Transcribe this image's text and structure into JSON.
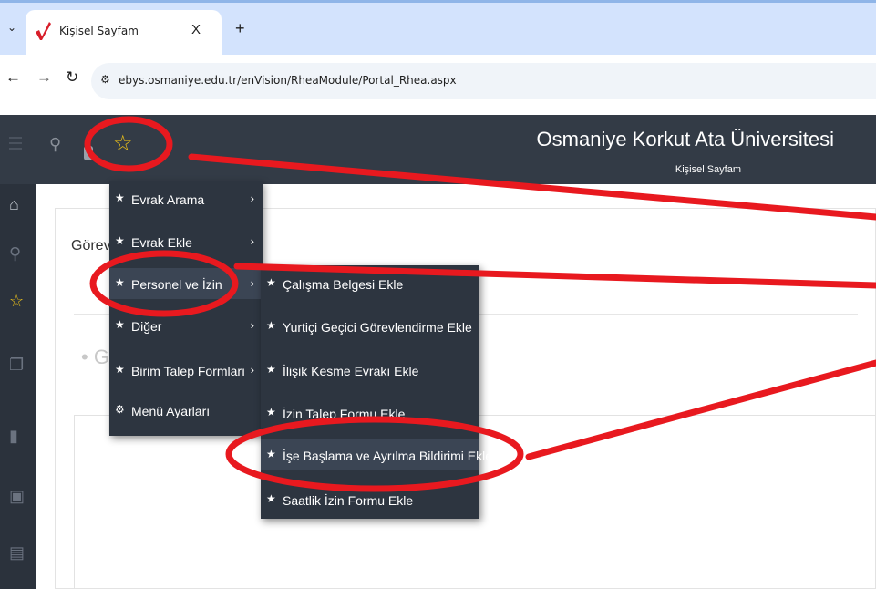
{
  "browser": {
    "tab_title": "Kişisel Sayfam",
    "tab_close": "X",
    "new_tab": "+",
    "url": "ebys.osmaniye.edu.tr/enVision/RheaModule/Portal_Rhea.aspx",
    "icons": {
      "tab_list": "chevron-down-icon",
      "back": "arrow-left-icon",
      "forward": "arrow-right-icon",
      "reload": "reload-icon",
      "site_info": "tune-icon"
    }
  },
  "header": {
    "university_name": "Osmaniye Korkut Ata Üniversitesi",
    "page_subtitle": "Kişisel Sayfam"
  },
  "content": {
    "section_label": "Görev",
    "faded_text": "• G"
  },
  "menu_primary": [
    {
      "label": "Evrak Arama",
      "icon": "star-icon",
      "has_submenu": true
    },
    {
      "label": "Evrak Ekle",
      "icon": "star-icon",
      "has_submenu": true
    },
    {
      "label": "Personel ve İzin",
      "icon": "star-icon",
      "has_submenu": true,
      "active": true
    },
    {
      "label": "Diğer",
      "icon": "star-icon",
      "has_submenu": true
    },
    {
      "label": "Birim Talep Formları",
      "icon": "star-icon",
      "has_submenu": true
    },
    {
      "label": "Menü Ayarları",
      "icon": "gear-icon",
      "has_submenu": false
    }
  ],
  "menu_secondary": [
    {
      "label": "Çalışma Belgesi Ekle",
      "icon": "star-icon"
    },
    {
      "label": "Yurtiçi Geçici Görevlendirme Ekle",
      "icon": "star-icon"
    },
    {
      "label": "İlişik Kesme Evrakı Ekle",
      "icon": "star-icon"
    },
    {
      "label": "İzin Talep Formu Ekle",
      "icon": "star-icon"
    },
    {
      "label": "İşe Başlama ve Ayrılma Bildirimi Ekle",
      "icon": "star-icon",
      "active": true
    },
    {
      "label": "Saatlik İzin Formu Ekle",
      "icon": "star-icon"
    }
  ],
  "colors": {
    "header_bg": "#333b46",
    "sidebar_bg": "#2b323c",
    "menu_bg": "#2d3540",
    "accent_star": "#f0c419",
    "annotation_red": "#e8191f"
  }
}
